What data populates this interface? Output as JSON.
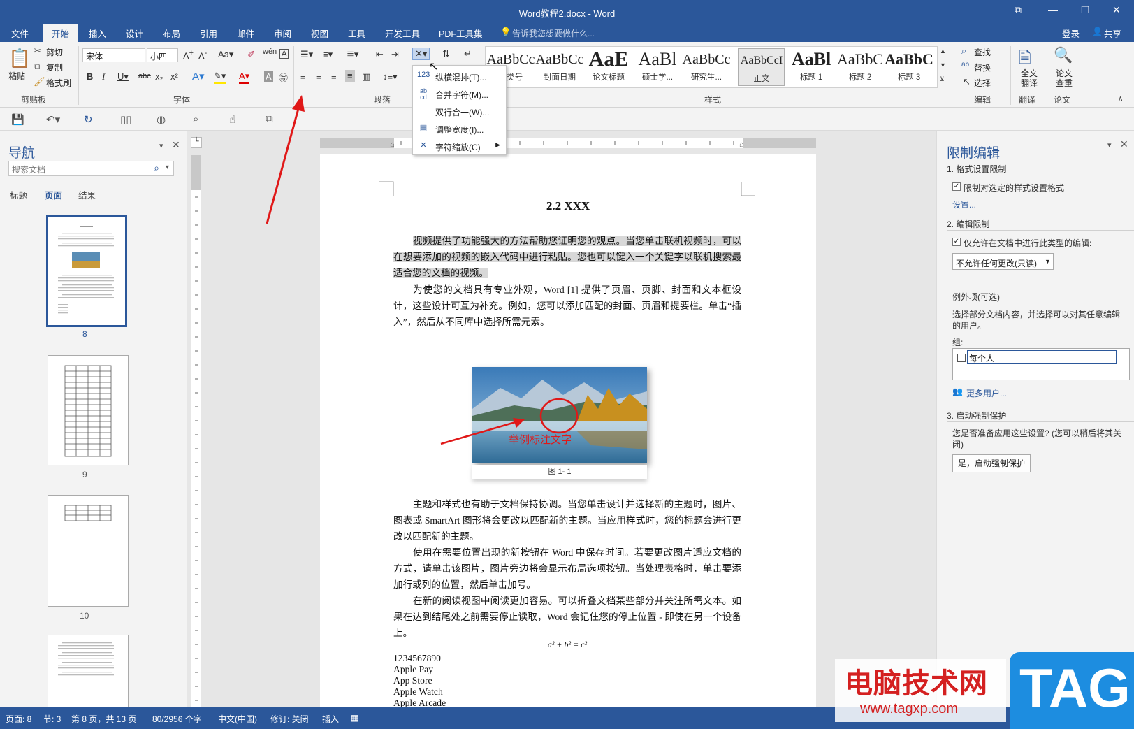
{
  "window": {
    "title": "Word教程2.docx - Word",
    "minimize": "—",
    "restore": "❐",
    "close": "✕",
    "options": "⧉"
  },
  "tabs": [
    "文件",
    "开始",
    "插入",
    "设计",
    "布局",
    "引用",
    "邮件",
    "审阅",
    "视图",
    "工具",
    "开发工具",
    "PDF工具集"
  ],
  "tell_me": "告诉我您想要做什么...",
  "account": {
    "login": "登录",
    "share": "共享"
  },
  "ribbon": {
    "clipboard": {
      "paste": "粘贴",
      "cut": "剪切",
      "copy": "复制",
      "format_painter": "格式刷",
      "label": "剪贴板"
    },
    "font": {
      "name": "宋体",
      "size": "小四",
      "label": "字体"
    },
    "paragraph": {
      "label": "段落"
    },
    "styles": {
      "label": "样式",
      "items": [
        {
          "preview": "AaBbCc",
          "name": "分类号"
        },
        {
          "preview": "AaBbCc",
          "name": "封面日期"
        },
        {
          "preview": "AaE",
          "name": "论文标题"
        },
        {
          "preview": "AaBl",
          "name": "硕士学..."
        },
        {
          "preview": "AaBbCc",
          "name": "研究生..."
        },
        {
          "preview": "AaBbCcI",
          "name": "正文"
        },
        {
          "preview": "AaBl",
          "name": "标题 1"
        },
        {
          "preview": "AaBbC",
          "name": "标题 2"
        },
        {
          "preview": "AaBbC",
          "name": "标题 3"
        }
      ]
    },
    "editing": {
      "find": "查找",
      "replace": "替换",
      "select": "选择",
      "label": "编辑"
    },
    "translate": {
      "full": "全文翻译",
      "label": "翻译"
    },
    "thesis": {
      "check": "论文查重",
      "label": "论文"
    }
  },
  "dropdown_menu": [
    {
      "icon": "123",
      "label": "纵横混排(T)..."
    },
    {
      "icon": "ab cd",
      "label": "合并字符(M)..."
    },
    {
      "icon": "",
      "label": "双行合一(W)..."
    },
    {
      "icon": "▤",
      "label": "调整宽度(I)..."
    },
    {
      "icon": "✕",
      "label": "字符缩放(C)"
    }
  ],
  "navigation": {
    "title": "导航",
    "search_placeholder": "搜索文档",
    "tabs": [
      "标题",
      "页面",
      "结果"
    ],
    "pages": [
      "8",
      "9",
      "10"
    ]
  },
  "document": {
    "heading": "2.2 XXX",
    "para1": "视频提供了功能强大的方法帮助您证明您的观点。当您单击联机视频时，可以在想要添加的视频的嵌入代码中进行粘贴。您也可以键入一个关键字以联机搜索最适合您的文档的视频。",
    "para2": "为使您的文档具有专业外观，Word [1] 提供了页眉、页脚、封面和文本框设计，这些设计可互为补充。例如，您可以添加匹配的封面、页眉和提要栏。单击“插入”，然后从不同库中选择所需元素。",
    "image_annotation": "举例标注文字",
    "caption": "图 1- 1",
    "para3": "主题和样式也有助于文档保持协调。当您单击设计并选择新的主题时，图片、图表或 SmartArt 图形将会更改以匹配新的主题。当应用样式时，您的标题会进行更改以匹配新的主题。",
    "para4": "使用在需要位置出现的新按钮在 Word 中保存时间。若要更改图片适应文档的方式，请单击该图片，图片旁边将会显示布局选项按钮。当处理表格时，单击要添加行或列的位置，然后单击加号。",
    "para5": "在新的阅读视图中阅读更加容易。可以折叠文档某些部分并关注所需文本。如果在达到结尾处之前需要停止读取，Word 会记住您的停止位置 - 即使在另一个设备上。",
    "equation": "a² + b² = c²",
    "list": [
      "1234567890",
      "Apple Pay",
      "App Store",
      "Apple Watch",
      "Apple Arcade"
    ]
  },
  "restrict_panel": {
    "title": "限制编辑",
    "s1": "1. 格式设置限制",
    "s1_check": "限制对选定的样式设置格式",
    "s1_link": "设置...",
    "s2": "2. 编辑限制",
    "s2_check": "仅允许在文档中进行此类型的编辑:",
    "s2_select": "不允许任何更改(只读)",
    "exceptions": "例外项(可选)",
    "exceptions_desc": "选择部分文档内容，并选择可以对其任意编辑的用户。",
    "group_label": "组:",
    "group_item": "每个人",
    "more_users": "更多用户...",
    "s3": "3. 启动强制保护",
    "s3_desc": "您是否准备应用这些设置? (您可以稍后将其关闭)",
    "s3_button": "是，启动强制保护"
  },
  "status": {
    "page": "页面: 8",
    "section": "节: 3",
    "page_of": "第 8 页，共 13 页",
    "words": "80/2956 个字",
    "lang": "中文(中国)",
    "revision": "修订: 关闭",
    "insert": "插入"
  },
  "watermark": {
    "text": "电脑技术网",
    "url": "www.tagxp.com",
    "logo": "TAG"
  }
}
